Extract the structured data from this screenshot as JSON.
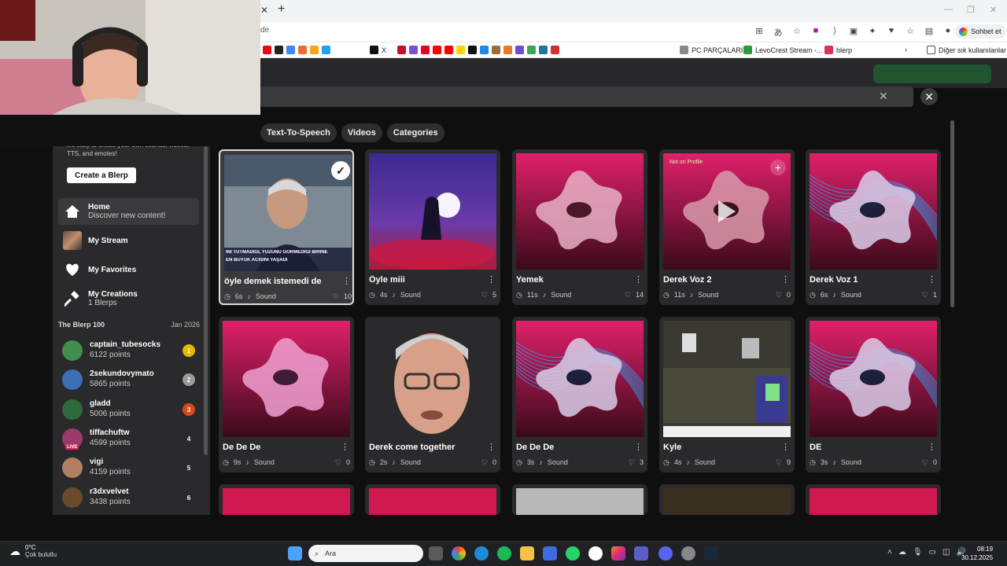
{
  "browser": {
    "url_fragment": "de",
    "copilot_label": "Sohbet et",
    "bookmarks": [
      {
        "label": "X",
        "color": "#111"
      },
      {
        "label": "PC PARÇALARI",
        "color": "#888"
      },
      {
        "label": "LevoCrest Stream -...",
        "color": "#2c9a3c"
      },
      {
        "label": "blerp",
        "color": "#d9335c"
      }
    ],
    "bookmarks_folder": "Diğer sık kullanılanlar"
  },
  "filters": [
    "Text-To-Speech",
    "Videos",
    "Categories"
  ],
  "sidebar": {
    "promo_text": "It's easy to create your own sounds, videos, TTS, and emotes!",
    "create_button": "Create a Blerp",
    "nav": [
      {
        "title": "Home",
        "sub": "Discover new content!",
        "icon": "home-icon"
      },
      {
        "title": "My Stream",
        "sub": "",
        "icon": "stream-avatar"
      },
      {
        "title": "My Favorites",
        "sub": "",
        "icon": "heart-icon"
      },
      {
        "title": "My Creations",
        "sub": "1 Blerps",
        "icon": "hammer-icon"
      }
    ],
    "blerp100_title": "The Blerp 100",
    "blerp100_date": "Jan 2026",
    "leaderboard": [
      {
        "name": "captain_tubesocks",
        "points": "6122 points",
        "rank": "1",
        "rank_color": "#e6b800",
        "av": "#3f8f4f"
      },
      {
        "name": "2sekundovymato",
        "points": "5865 points",
        "rank": "2",
        "rank_color": "#9a9a9a",
        "av": "#3b6fb5"
      },
      {
        "name": "gladd",
        "points": "5006 points",
        "rank": "3",
        "rank_color": "#d84a1b",
        "av": "#2f6a3c"
      },
      {
        "name": "tiffachuftw",
        "points": "4599 points",
        "rank": "4",
        "rank_color": "#2a2a2c",
        "av": "#9a3a6a",
        "live": "LIVE"
      },
      {
        "name": "vigi",
        "points": "4159 points",
        "rank": "5",
        "rank_color": "#2a2a2c",
        "av": "#b08060"
      },
      {
        "name": "r3dxvelvet",
        "points": "3438 points",
        "rank": "6",
        "rank_color": "#2a2a2c",
        "av": "#6a4a2a"
      }
    ]
  },
  "cards": [
    {
      "title": "öyle demek istemedi de",
      "duration": "6s",
      "type": "Sound",
      "likes": "10",
      "thumb": "photo-man",
      "selected": true,
      "caption1": "İNİ TUTMADIĞI, YÜZÜNÜ GÖRMEDİĞİ BİRİNE",
      "caption2": "EN BÜYÜK ACISINI YAŞADI"
    },
    {
      "title": "Öyle miii",
      "duration": "4s",
      "type": "Sound",
      "likes": "5",
      "thumb": "purple-moon"
    },
    {
      "title": "Yemek",
      "duration": "11s",
      "type": "Sound",
      "likes": "14",
      "thumb": "pink-star"
    },
    {
      "title": "Derek Voz 2",
      "duration": "11s",
      "type": "Sound",
      "likes": "0",
      "thumb": "dark-pink-star",
      "overlay_text": "Not on Profile"
    },
    {
      "title": "Derek Voz 1",
      "duration": "6s",
      "type": "Sound",
      "likes": "1",
      "thumb": "blue-star"
    },
    {
      "title": "De De De",
      "duration": "9s",
      "type": "Sound",
      "likes": "0",
      "thumb": "magenta-star"
    },
    {
      "title": "Derek come together",
      "duration": "2s",
      "type": "Sound",
      "likes": "0",
      "thumb": "face-man"
    },
    {
      "title": "De De De",
      "duration": "3s",
      "type": "Sound",
      "likes": "3",
      "thumb": "blue-star"
    },
    {
      "title": "Kyle",
      "duration": "4s",
      "type": "Sound",
      "likes": "9",
      "thumb": "room"
    },
    {
      "title": "DE",
      "duration": "3s",
      "type": "Sound",
      "likes": "0",
      "thumb": "blue-star"
    }
  ],
  "taskbar": {
    "temp": "0°C",
    "condition": "Çok bulutlu",
    "search": "Ara",
    "time": "08:19",
    "date": "30.12.2025"
  }
}
